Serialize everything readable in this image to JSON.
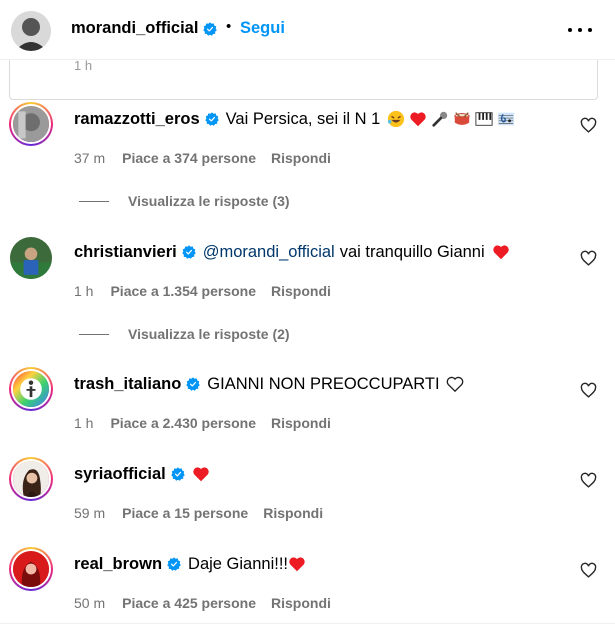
{
  "header": {
    "username": "morandi_official",
    "dot": "•",
    "follow_label": "Segui"
  },
  "caption_time": "1 h",
  "comments": [
    {
      "username": "ramazzotti_eros",
      "verified": true,
      "text": "Vai Persica, sei il N 1",
      "emojis": [
        "rofl-emoji",
        "red-heart-emoji",
        "microphone-emoji",
        "drum-emoji",
        "piano-emoji",
        "music-score-emoji"
      ],
      "time": "37 m",
      "likes": "Piace a 374 persone",
      "reply": "Rispondi",
      "replies": "Visualizza le risposte (3)"
    },
    {
      "username": "christianvieri",
      "verified": true,
      "mention": "@morandi_official",
      "text": "vai tranquillo Gianni",
      "emojis": [
        "red-heart-emoji"
      ],
      "time": "1 h",
      "likes": "Piace a 1.354 persone",
      "reply": "Rispondi",
      "replies": "Visualizza le risposte (2)"
    },
    {
      "username": "trash_italiano",
      "verified": true,
      "text": "GIANNI NON PREOCCUPARTI",
      "emojis": [
        "white-heart-emoji"
      ],
      "time": "1 h",
      "likes": "Piace a 2.430 persone",
      "reply": "Rispondi"
    },
    {
      "username": "syriaofficial",
      "verified": true,
      "text": "",
      "emojis": [
        "red-heart-emoji"
      ],
      "time": "59 m",
      "likes": "Piace a 15 persone",
      "reply": "Rispondi"
    },
    {
      "username": "real_brown",
      "verified": true,
      "text": "Daje Gianni!!!",
      "emojis": [
        "red-heart-emoji"
      ],
      "time": "50 m",
      "likes": "Piace a 425 persone",
      "reply": "Rispondi"
    }
  ],
  "colors": {
    "link_blue": "#0095f6",
    "mention": "#00376b",
    "muted": "#737373",
    "verified": "#0095f6",
    "heart_red": "#ed1c24"
  }
}
